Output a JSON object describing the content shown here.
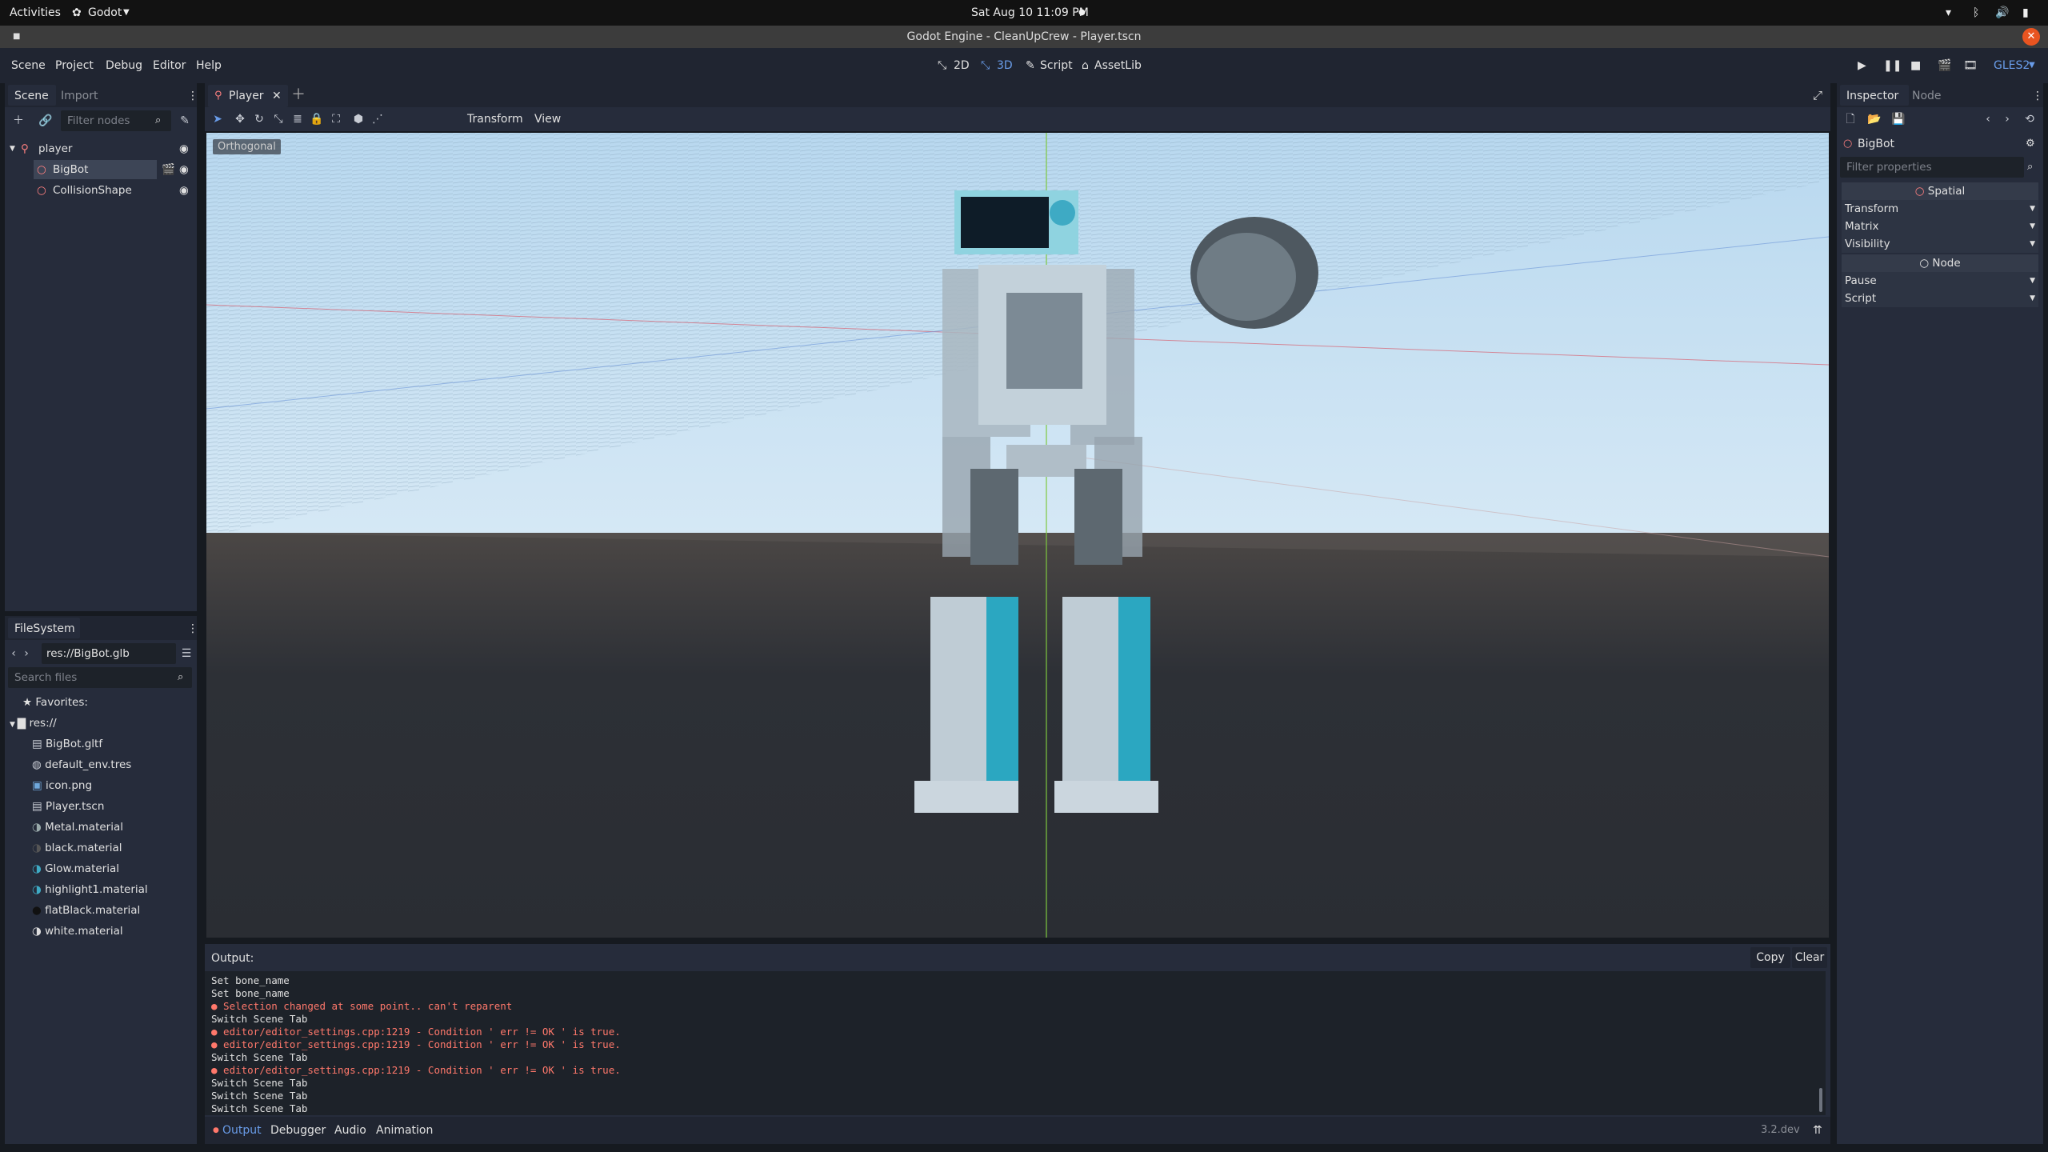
{
  "gnome": {
    "activities": "Activities",
    "app": "Godot",
    "clock": "Sat Aug 10  11:09 PM"
  },
  "window": {
    "title": "Godot Engine - CleanUpCrew - Player.tscn"
  },
  "menu": {
    "items": [
      "Scene",
      "Project",
      "Debug",
      "Editor",
      "Help"
    ],
    "workspaces": [
      "2D",
      "3D",
      "Script",
      "AssetLib"
    ],
    "renderer": "GLES2"
  },
  "scene_dock": {
    "tabs": [
      "Scene",
      "Import"
    ],
    "filter_placeholder": "Filter nodes",
    "nodes": [
      {
        "label": "player"
      },
      {
        "label": "BigBot"
      },
      {
        "label": "CollisionShape"
      }
    ]
  },
  "filesystem": {
    "title": "FileSystem",
    "path": "res://BigBot.glb",
    "search_placeholder": "Search files",
    "favorites": "Favorites:",
    "root": "res://",
    "files": [
      "BigBot.gltf",
      "default_env.tres",
      "icon.png",
      "Player.tscn",
      "Metal.material",
      "black.material",
      "Glow.material",
      "highlight1.material",
      "flatBlack.material",
      "white.material"
    ]
  },
  "editor_tab": {
    "label": "Player"
  },
  "viewport": {
    "toolbar_menus": [
      "Transform",
      "View"
    ],
    "view_label": "Orthogonal"
  },
  "output": {
    "title": "Output:",
    "copy": "Copy",
    "clear": "Clear",
    "lines": [
      {
        "text": "Set bone_name",
        "error": false
      },
      {
        "text": "Set bone_name",
        "error": false
      },
      {
        "text": "● Selection changed at some point.. can't reparent",
        "error": true
      },
      {
        "text": "Switch Scene Tab",
        "error": false
      },
      {
        "text": "● editor/editor_settings.cpp:1219 - Condition ' err != OK ' is true.",
        "error": true
      },
      {
        "text": "● editor/editor_settings.cpp:1219 - Condition ' err != OK ' is true.",
        "error": true
      },
      {
        "text": "Switch Scene Tab",
        "error": false
      },
      {
        "text": "● editor/editor_settings.cpp:1219 - Condition ' err != OK ' is true.",
        "error": true
      },
      {
        "text": "Switch Scene Tab",
        "error": false
      },
      {
        "text": "Switch Scene Tab",
        "error": false
      },
      {
        "text": "Switch Scene Tab",
        "error": false
      }
    ],
    "bottom_tabs": [
      "Output",
      "Debugger",
      "Audio",
      "Animation"
    ],
    "version": "3.2.dev"
  },
  "inspector": {
    "tabs": [
      "Inspector",
      "Node"
    ],
    "object": "BigBot",
    "filter_placeholder": "Filter properties",
    "sections": [
      {
        "header": "Spatial",
        "props": [
          "Transform",
          "Matrix",
          "Visibility"
        ]
      },
      {
        "header": "Node",
        "props": [
          "Pause",
          "Script"
        ]
      }
    ]
  },
  "colors": {
    "accent": "#699ce8",
    "error": "#ff786b",
    "selection": "#3d4556",
    "bg": "#202531"
  }
}
